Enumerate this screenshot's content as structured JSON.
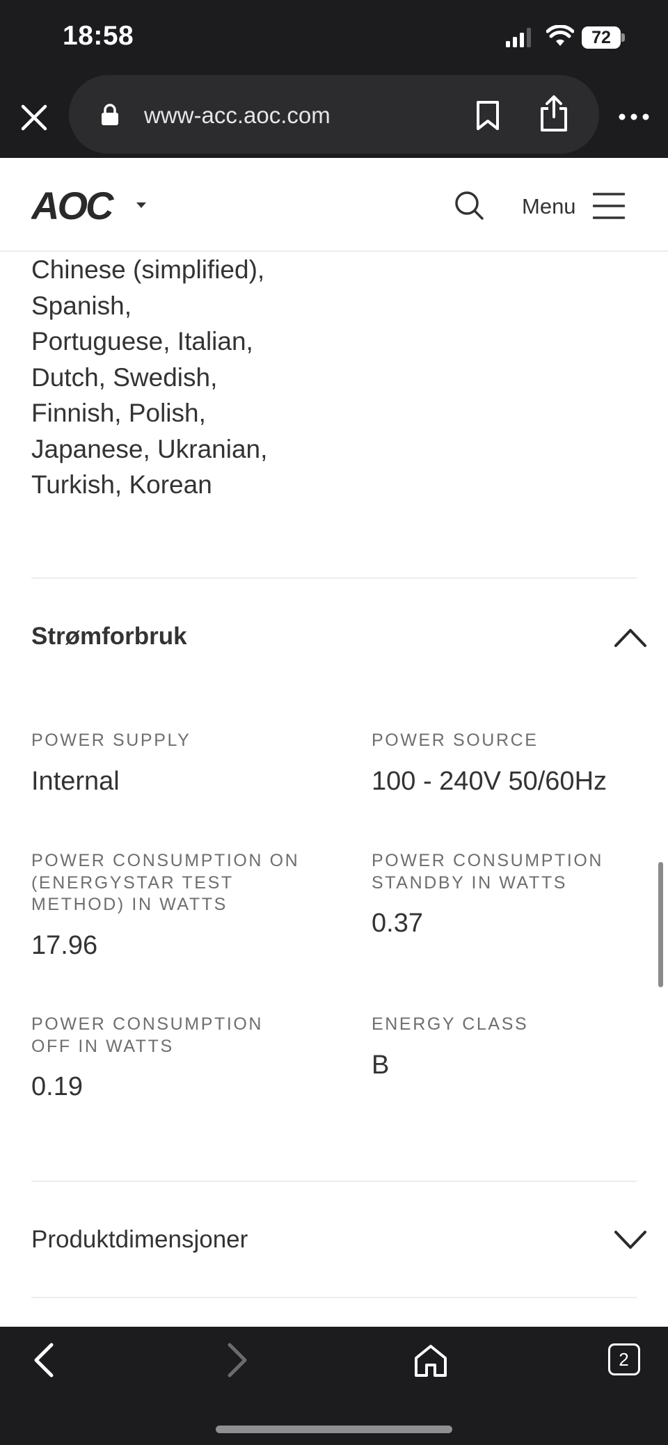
{
  "status_bar": {
    "time": "18:58",
    "battery_level": "72"
  },
  "browser": {
    "url": "www-acc.aoc.com",
    "tab_count": "2"
  },
  "site_header": {
    "logo_text": "AOC",
    "menu_label": "Menu"
  },
  "languages": {
    "lines": [
      "Chinese (simplified),",
      "Spanish,",
      "Portuguese, Italian,",
      "Dutch, Swedish,",
      "Finnish, Polish,",
      "Japanese, Ukranian,",
      "Turkish, Korean"
    ]
  },
  "power_section": {
    "title": "Strømforbruk",
    "expanded": true,
    "specs": {
      "power_supply": {
        "label": "POWER SUPPLY",
        "value": "Internal"
      },
      "power_source": {
        "label": "POWER SOURCE",
        "value": "100 - 240V 50/60Hz"
      },
      "consumption_on": {
        "label": "POWER CONSUMPTION ON (ENERGYSTAR TEST METHOD) IN WATTS",
        "value": "17.96"
      },
      "consumption_standby": {
        "label": "POWER CONSUMPTION STANDBY IN WATTS",
        "value": "0.37"
      },
      "consumption_off": {
        "label": "POWER CONSUMPTION OFF IN WATTS",
        "value": "0.19"
      },
      "energy_class": {
        "label": "ENERGY CLASS",
        "value": "B"
      }
    }
  },
  "dimensions_section": {
    "title": "Produktdimensjoner",
    "expanded": false
  },
  "icons": {
    "status": [
      "cellular-signal-icon",
      "wifi-icon",
      "battery-icon"
    ],
    "browser": [
      "close-icon",
      "lock-icon",
      "bookmark-icon",
      "share-icon",
      "more-icon"
    ],
    "header": [
      "search-icon",
      "hamburger-menu-icon",
      "chevron-down-icon"
    ],
    "bottom_nav": [
      "back-arrow-icon",
      "forward-arrow-icon",
      "home-icon",
      "tabs-icon"
    ]
  },
  "colors": {
    "chrome_dark": "#1c1c1e",
    "url_pill": "#2c2c2e",
    "text_primary": "#333333",
    "text_label": "#6e6e6e",
    "divider": "#ececec"
  }
}
